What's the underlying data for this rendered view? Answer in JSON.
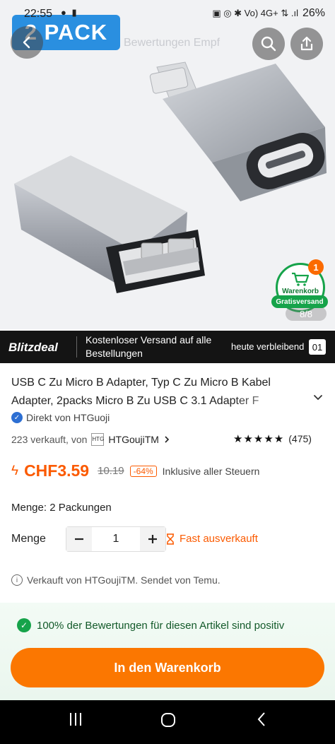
{
  "status_bar": {
    "time": "22:55",
    "left_icons": "● ▮",
    "right_icons": "▣ ◎ ✱ Vo) 4G+ ⇅ .ıl",
    "battery": "26%"
  },
  "header": {
    "pack_badge": "2 PACK",
    "ghost_tabs": "Bewertungen   Empf"
  },
  "gallery": {
    "counter": "8/8"
  },
  "cart_widget": {
    "count": "1",
    "label": "Warenkorb",
    "free_shipping": "Gratisversand"
  },
  "deal_banner": {
    "logo": "Blitzdeal",
    "text": "Kostenloser Versand auf alle Bestellungen",
    "remaining_label": "heute verbleibend",
    "remaining_value": "01"
  },
  "product": {
    "title": "USB C Zu Micro B Adapter, Typ C Zu Micro B Kabel Adapter, 2packs Micro B Zu USB C 3.1 Adapter F",
    "seller_direct": "Direkt von HTGuoji",
    "sold_count": "223 verkauft, von",
    "store_logo": "HTG",
    "store_name": "HTGoujiTM",
    "rating_stars": "★★★★★",
    "rating_value": 4.8,
    "review_count": "(475)",
    "price": "CHF3.59",
    "old_price": "10.19",
    "discount": "-64%",
    "tax_note": "Inklusive aller Steuern",
    "pack_selection": "Menge: 2 Packungen",
    "quantity_label": "Menge",
    "quantity": "1",
    "almost_sold_out": "Fast ausverkauft",
    "sold_by": "Verkauft von HTGoujiTM. Sendet von Temu."
  },
  "bottom": {
    "positive_note": "100% der Bewertungen für diesen Artikel sind positiv",
    "cart_button": "In den Warenkorb"
  },
  "colors": {
    "accent_orange": "#fb7701",
    "price_orange": "#fb5a00",
    "positive_green": "#16a34a",
    "badge_blue": "#2a8fe0"
  }
}
